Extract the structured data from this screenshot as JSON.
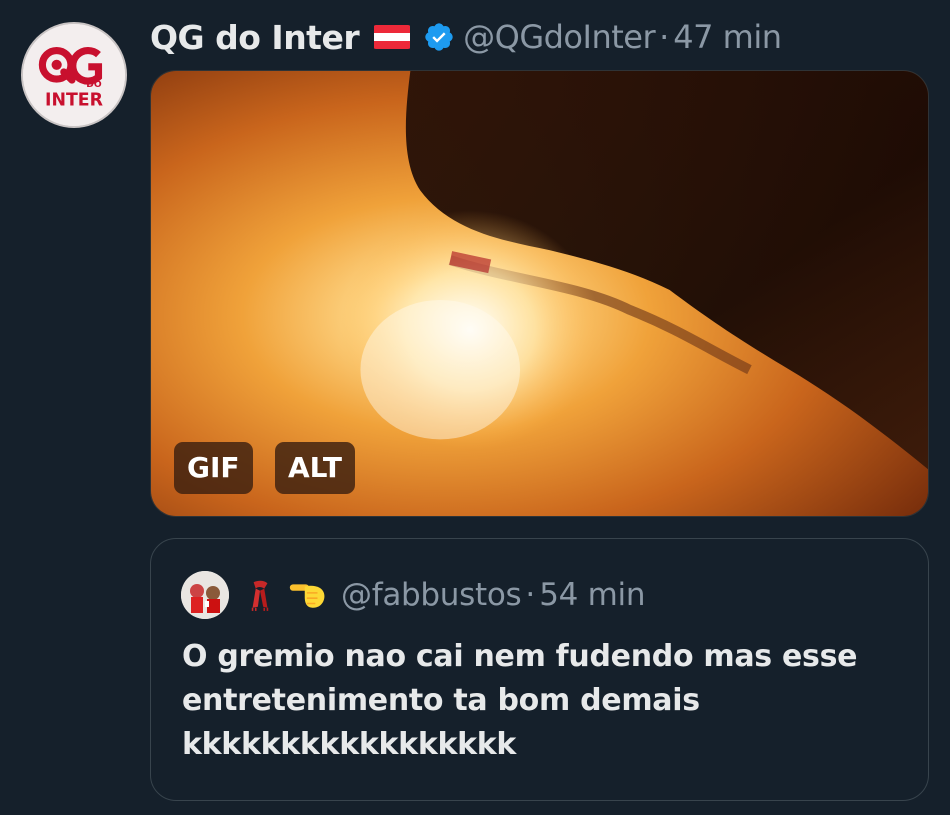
{
  "tweet": {
    "display_name": "QG do Inter",
    "handle": "@QGdoInter",
    "separator": "·",
    "time": "47 min",
    "flag_icon": "austria-flag-icon",
    "verified_icon": "verified-badge-icon",
    "avatar": {
      "logo_text": "QG DO INTER",
      "colors": {
        "brand_red": "#c8102e",
        "background": "#f3eeee"
      }
    },
    "media": {
      "type": "gif",
      "gif_badge": "GIF",
      "alt_badge": "ALT"
    }
  },
  "quoted_tweet": {
    "handle": "@fabbustos",
    "separator": "·",
    "time": "54 min",
    "emoji_icons": [
      "red-scarf-icon",
      "pointing-hand-icon"
    ],
    "text_lines": [
      "O gremio nao cai nem fudendo mas esse",
      "entretenimento ta bom demais",
      "kkkkkkkkkkkkkkkkk"
    ]
  },
  "theme": {
    "background": "#15202b",
    "text_primary": "#e7e9ea",
    "text_secondary": "#8b98a5",
    "verified_blue": "#1d9bf0",
    "border": "#38444d"
  }
}
